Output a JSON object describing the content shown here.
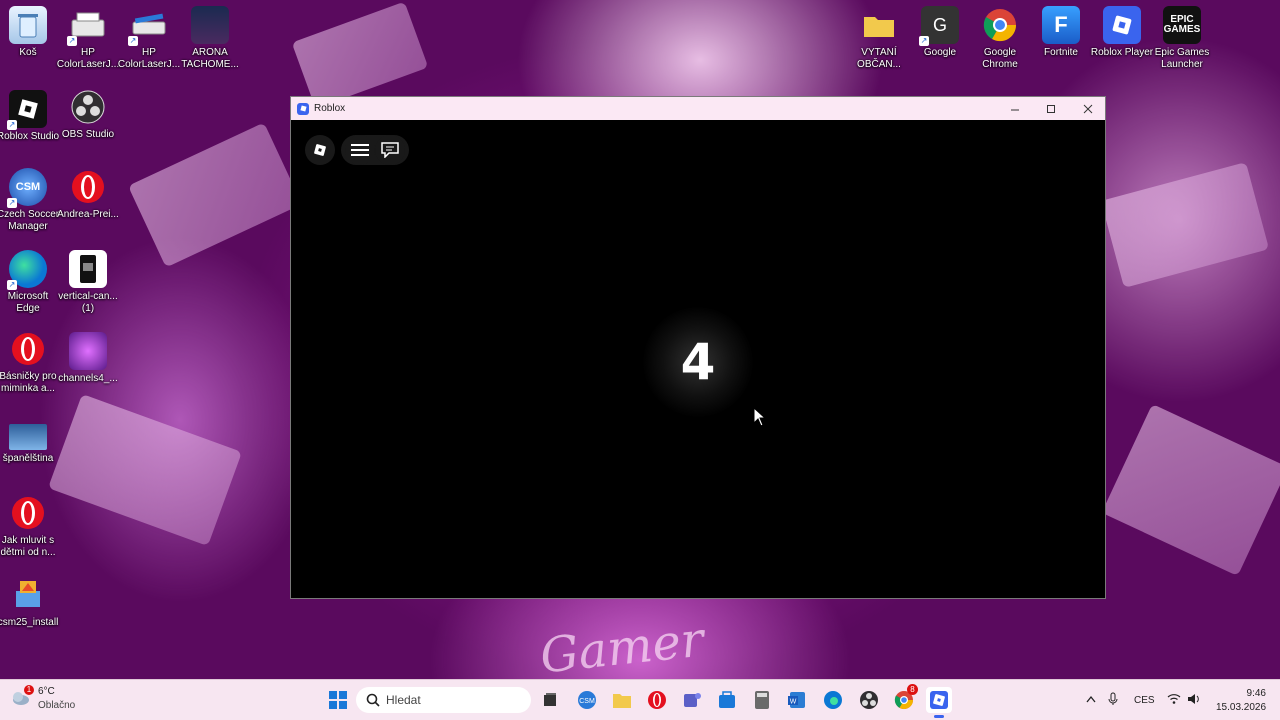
{
  "desktop": {
    "icons": [
      {
        "label": "Koš"
      },
      {
        "label": "HP ColorLaserJ..."
      },
      {
        "label": "HP ColorLaserJ..."
      },
      {
        "label": "ARONA TACHOME..."
      },
      {
        "label": "Roblox Studio"
      },
      {
        "label": "OBS Studio"
      },
      {
        "label": "Czech Soccer Manager"
      },
      {
        "label": "Andrea-Prei..."
      },
      {
        "label": "Microsoft Edge"
      },
      {
        "label": "vertical-can... (1)"
      },
      {
        "label": "Básničky pro miminka a..."
      },
      {
        "label": "channels4_..."
      },
      {
        "label": "španělština"
      },
      {
        "label": "Jak mluvit s dětmi od n..."
      },
      {
        "label": "csm25_install"
      },
      {
        "label": "VYTANÍ OBČAN..."
      },
      {
        "label": "Google"
      },
      {
        "label": "Google Chrome"
      },
      {
        "label": "Fortnite"
      },
      {
        "label": "Roblox Player"
      },
      {
        "label": "Epic Games Launcher"
      }
    ],
    "wallpaper_text": "Gamer"
  },
  "window": {
    "title": "Roblox",
    "countdown": "4",
    "icons": [
      "roblox-logo-icon",
      "menu-icon",
      "chat-icon"
    ]
  },
  "taskbar": {
    "weather": {
      "temp": "6°C",
      "condition": "Oblačno",
      "badge": "1"
    },
    "search_placeholder": "Hledat",
    "language": "CES",
    "time": "9:46",
    "date": "15.03.2026",
    "chrome_badge": "8"
  },
  "colors": {
    "accent": "#3a64ee",
    "titlebar": "#fbe8f4",
    "taskbar": "#f7e6f1"
  }
}
